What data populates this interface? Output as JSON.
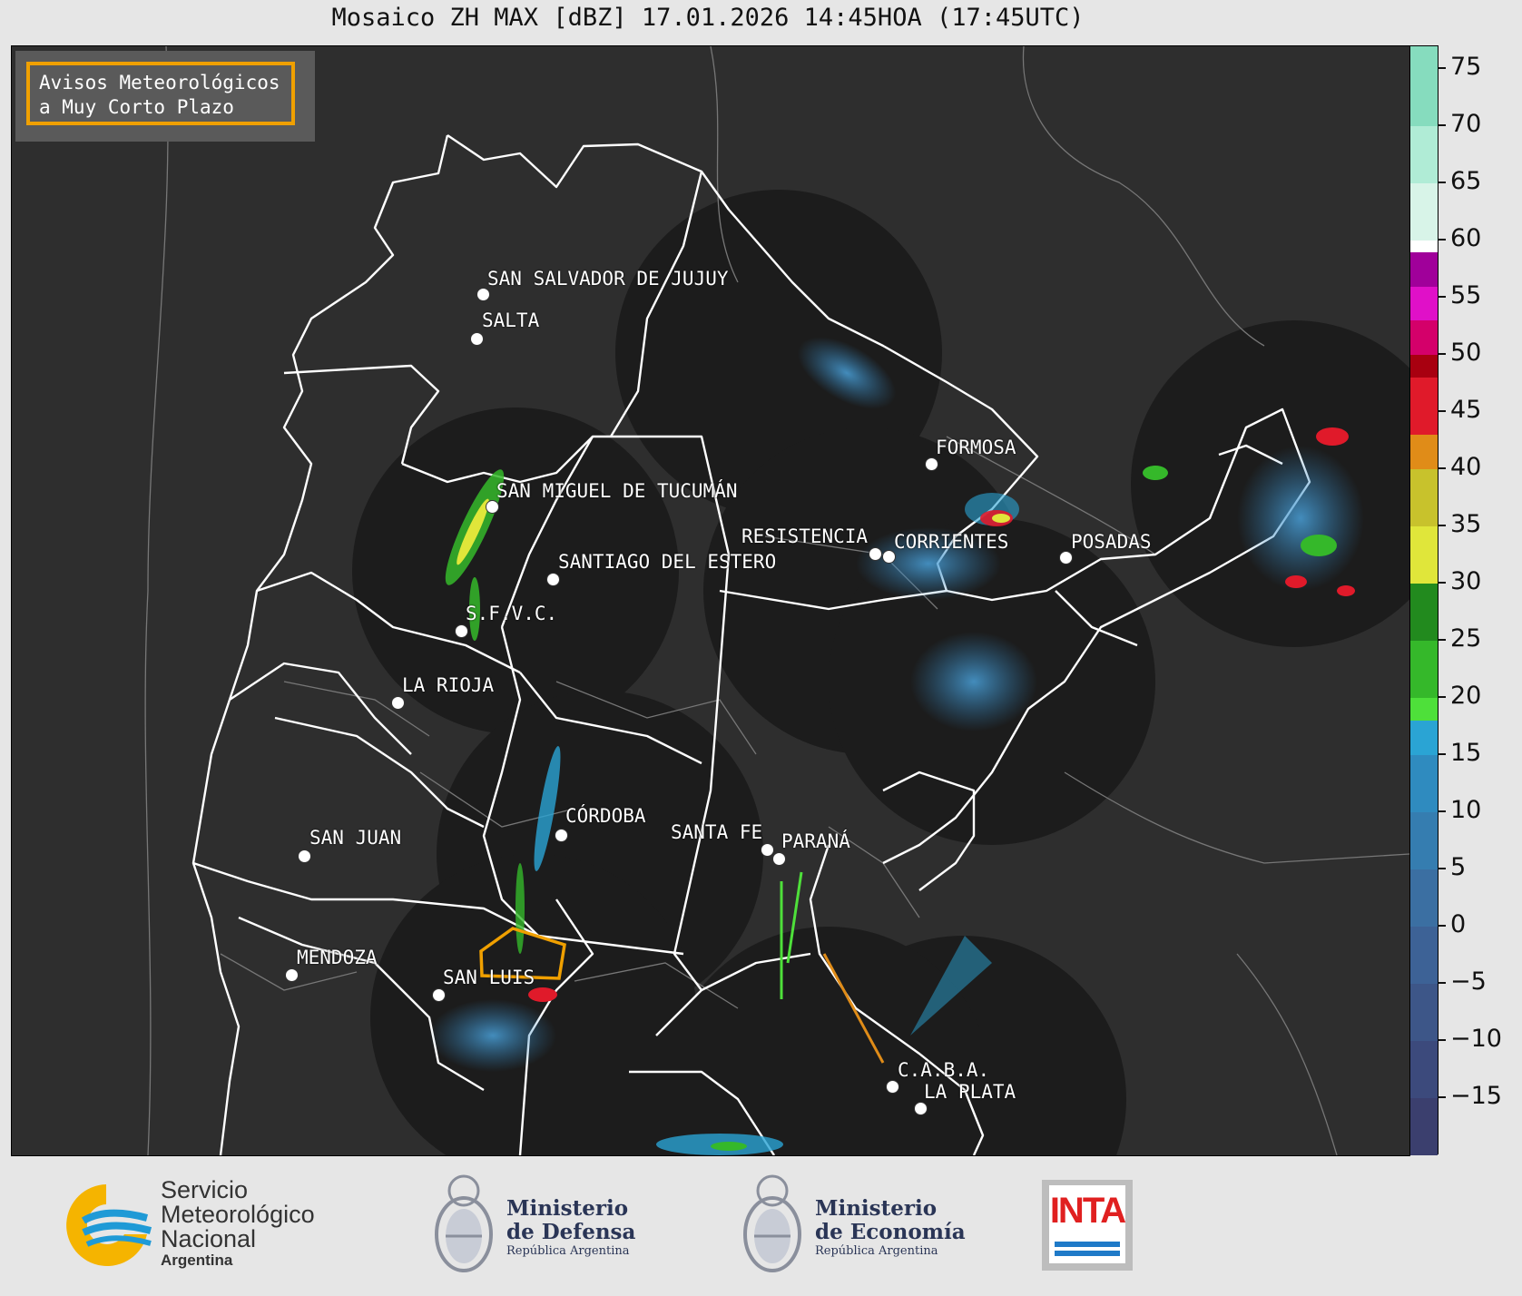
{
  "title": "Mosaico ZH MAX [dBZ] 17.01.2026 14:45HOA (17:45UTC)",
  "legend_box": {
    "line1": "Avisos Meteorológicos",
    "line2": "a Muy Corto Plazo",
    "border_color": "#f0a000"
  },
  "cities": [
    {
      "name": "SAN SALVADOR DE JUJUY"
    },
    {
      "name": "SALTA"
    },
    {
      "name": "SAN MIGUEL DE TUCUMÁN"
    },
    {
      "name": "SANTIAGO DEL ESTERO"
    },
    {
      "name": "S.F.V.C."
    },
    {
      "name": "LA RIOJA"
    },
    {
      "name": "FORMOSA"
    },
    {
      "name": "RESISTENCIA"
    },
    {
      "name": "CORRIENTES"
    },
    {
      "name": "POSADAS"
    },
    {
      "name": "CÓRDOBA"
    },
    {
      "name": "SANTA FE"
    },
    {
      "name": "PARANÁ"
    },
    {
      "name": "SAN JUAN"
    },
    {
      "name": "MENDOZA"
    },
    {
      "name": "SAN LUIS"
    },
    {
      "name": "C.A.B.A."
    },
    {
      "name": "LA PLATA"
    }
  ],
  "colorbar": {
    "unit": "dBZ",
    "min": -20,
    "max": 77,
    "ticks": [
      "75",
      "70",
      "65",
      "60",
      "55",
      "50",
      "45",
      "40",
      "35",
      "30",
      "25",
      "20",
      "15",
      "10",
      "5",
      "0",
      "−5",
      "−10",
      "−15"
    ],
    "stops": [
      {
        "from": -20,
        "to": -15,
        "color": "#3b3f6e"
      },
      {
        "from": -15,
        "to": -10,
        "color": "#3c4a7c"
      },
      {
        "from": -10,
        "to": -5,
        "color": "#3d5688"
      },
      {
        "from": -5,
        "to": 0,
        "color": "#3d6296"
      },
      {
        "from": 0,
        "to": 5,
        "color": "#3b6fa2"
      },
      {
        "from": 5,
        "to": 10,
        "color": "#357db0"
      },
      {
        "from": 10,
        "to": 15,
        "color": "#2f8bbf"
      },
      {
        "from": 15,
        "to": 18,
        "color": "#2aa4d4"
      },
      {
        "from": 18,
        "to": 20,
        "color": "#4ee03a"
      },
      {
        "from": 20,
        "to": 25,
        "color": "#35b82a"
      },
      {
        "from": 25,
        "to": 30,
        "color": "#228a1e"
      },
      {
        "from": 30,
        "to": 35,
        "color": "#e0e63a"
      },
      {
        "from": 35,
        "to": 40,
        "color": "#c8c22c"
      },
      {
        "from": 40,
        "to": 43,
        "color": "#e08c18"
      },
      {
        "from": 43,
        "to": 48,
        "color": "#e01a2a"
      },
      {
        "from": 48,
        "to": 50,
        "color": "#a80010"
      },
      {
        "from": 50,
        "to": 53,
        "color": "#d4006a"
      },
      {
        "from": 53,
        "to": 56,
        "color": "#e010c8"
      },
      {
        "from": 56,
        "to": 59,
        "color": "#a0009a"
      },
      {
        "from": 59,
        "to": 60,
        "color": "#ffffff"
      },
      {
        "from": 60,
        "to": 65,
        "color": "#d8f4e8"
      },
      {
        "from": 65,
        "to": 70,
        "color": "#b0ecd6"
      },
      {
        "from": 70,
        "to": 77,
        "color": "#86dcbe"
      }
    ]
  },
  "footer": {
    "smn": {
      "line1": "Servicio",
      "line2": "Meteorológico",
      "line3": "Nacional",
      "line4": "Argentina"
    },
    "defensa": {
      "line1": "Ministerio",
      "line2": "de Defensa",
      "sub": "República Argentina"
    },
    "economia": {
      "line1": "Ministerio",
      "line2": "de Economía",
      "sub": "República Argentina"
    },
    "inta": {
      "label": "INTA"
    }
  }
}
